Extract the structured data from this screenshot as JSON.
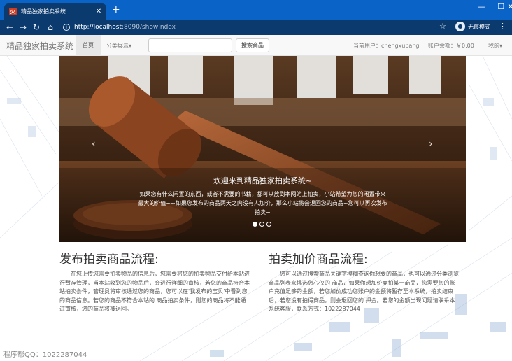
{
  "browser": {
    "tab_title": "精品独家拍卖系统",
    "url_host": "http://localhost",
    "url_path": ":8090/showIndex",
    "incognito_label": "无痕模式"
  },
  "navbar": {
    "brand": "精品独家拍卖系统",
    "home": "首页",
    "category": "分类展示▾",
    "search_placeholder": "",
    "search_button": "搜索商品",
    "current_user_label": "当前用户：chengxubang",
    "balance_label": "账户余额：￥0.00",
    "my_menu": "我的▾"
  },
  "carousel": {
    "caption_title": "欢迎来到精品独家拍卖系统~",
    "caption_text": "如果您有什么闲置的东西，或者不需要的书籍，都可以放到本网站上拍卖，小站希望为您的闲置带来最大的价值~~如果您发布的商品两天之内没有人加价，那么小站将会退回您的商品~您可以再次发布拍卖~",
    "slides": 3,
    "active": 0
  },
  "sections": {
    "publish_title": "发布拍卖商品流程:",
    "publish_text": "在您上传您需要拍卖物品的信息后，您需要将您的拍卖物品交付给本站进行暂存管理，当本站收到您的物品后，会进行详细的审核，若您的商品符合本站拍卖条件，管理员将审核通过您的商品，您可以在'我发布的宝贝'中看到您的商品信息。若您的商品不符合本站的 商品拍卖条件，则您的商品将不能通过审核，您的商品将被退回。",
    "bid_title": "拍卖加价商品流程:",
    "bid_text": "您可以通过搜索商品关键字模糊查询你想要的商品，也可以通过分类浏览商品列表来挑选您心仪的 商品，如果你想加价竞拍某一商品，您需要您的账户充值足够的金额，若您加价成功您账户的金额将暂存至本系统，拍卖结束后，若您没有拍得商品，则会退回您的 押金。若您的金额出现问题请联系本系统客服，联系方式：1022287044"
  },
  "footer": {
    "qq": "程序帮QQ：1022287044"
  },
  "colors": {
    "titlebar": "#0a64c8",
    "toolbar": "#0b3a6e",
    "navbar": "#f8f8f8"
  }
}
